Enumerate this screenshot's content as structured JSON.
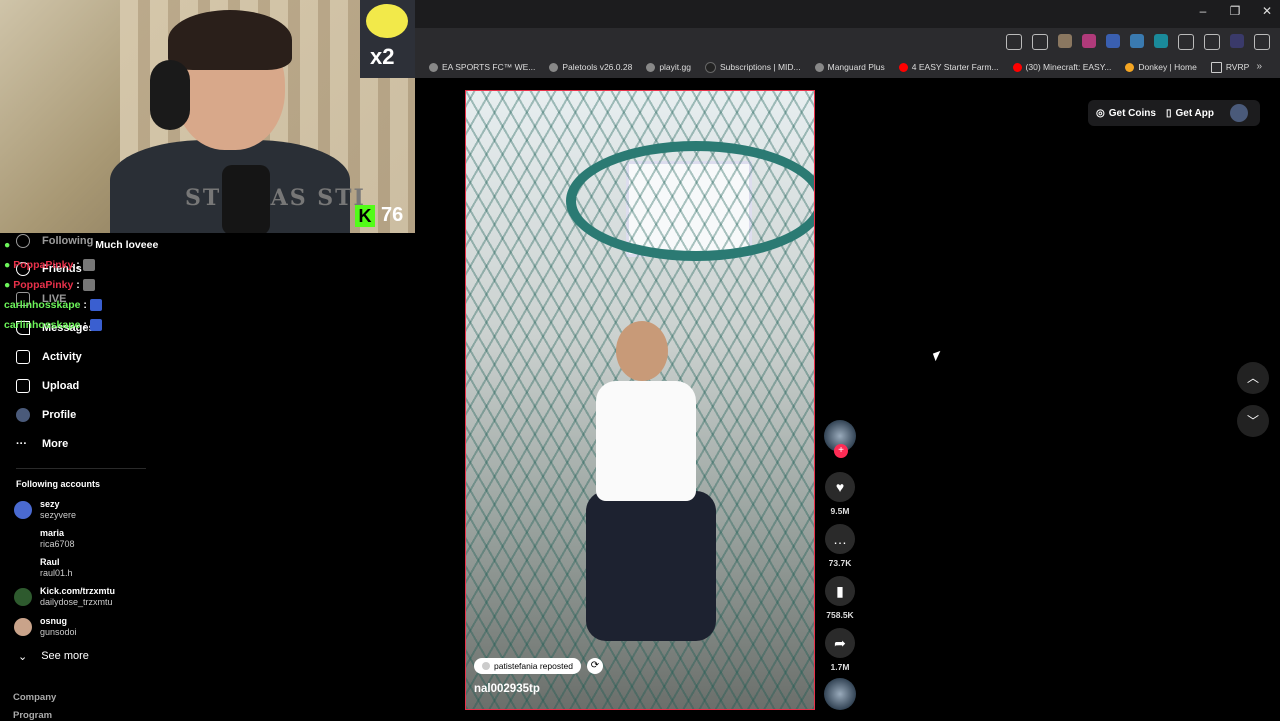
{
  "window": {
    "minimize": "–",
    "restore": "❐",
    "close": "✕"
  },
  "bookmarks": [
    {
      "label": "EA SPORTS FC™ WE...",
      "icon": "globe-icon",
      "color": "#8a8a8a"
    },
    {
      "label": "Paletools v26.0.28",
      "icon": "globe-icon",
      "color": "#8a8a8a"
    },
    {
      "label": "playit.gg",
      "icon": "globe-icon",
      "color": "#8a8a8a"
    },
    {
      "label": "Subscriptions | MID...",
      "icon": "midjourney-icon",
      "color": "#222222"
    },
    {
      "label": "Manguard Plus",
      "icon": "globe-icon",
      "color": "#8a8a8a"
    },
    {
      "label": "4 EASY Starter Farm...",
      "icon": "youtube-icon",
      "color": "#ff0000"
    },
    {
      "label": "(30) Minecraft: EASY...",
      "icon": "youtube-icon",
      "color": "#ff0000"
    },
    {
      "label": "Donkey | Home",
      "icon": "donkey-icon",
      "color": "#f5a623"
    },
    {
      "label": "RVRP",
      "icon": "folder-icon",
      "color": "#cccccc"
    }
  ],
  "bookmarks_more": "»",
  "webcam": {
    "multiplier": "x2",
    "kick_letter": "K",
    "kick_count": "76",
    "shirt_text": "STUP AS STI"
  },
  "chat": [
    {
      "user": "",
      "text": "Much loveee",
      "color": "#ffffff"
    },
    {
      "user": "PoppaPinky",
      "text": ":",
      "color": "#e8314a"
    },
    {
      "user": "PoppaPinky",
      "text": ":",
      "color": "#e8314a"
    },
    {
      "user": "carlinhosskape",
      "text": ":",
      "color": "#6cf45a"
    },
    {
      "user": "carlinhosskape",
      "text": ":",
      "color": "#6cf45a"
    }
  ],
  "nav": {
    "following": "Following",
    "friends": "Friends",
    "live": "LIVE",
    "messages": "Messages",
    "activity": "Activity",
    "upload": "Upload",
    "profile": "Profile",
    "more": "More"
  },
  "following_title": "Following accounts",
  "accounts": [
    {
      "name": "sezy",
      "handle": "sezyvere"
    },
    {
      "name": "maria",
      "handle": "rica6708"
    },
    {
      "name": "Raul",
      "handle": "raul01.h"
    },
    {
      "name": "Kick.com/trzxmtu",
      "handle": "dailydose_trzxmtu"
    },
    {
      "name": "osnug",
      "handle": "gunsodoi"
    }
  ],
  "see_more": "See more",
  "footer": {
    "company": "Company",
    "program": "Program"
  },
  "video": {
    "repost_label": "patistefania reposted",
    "username": "nal002935tp"
  },
  "actions": {
    "likes": "9.5M",
    "comments": "73.7K",
    "saves": "758.5K",
    "shares": "1.7M"
  },
  "topbar": {
    "get_coins": "Get Coins",
    "get_app": "Get App"
  },
  "colors": {
    "accent": "#fe2c55",
    "kick": "#53fc18",
    "border": "#e8314a"
  }
}
